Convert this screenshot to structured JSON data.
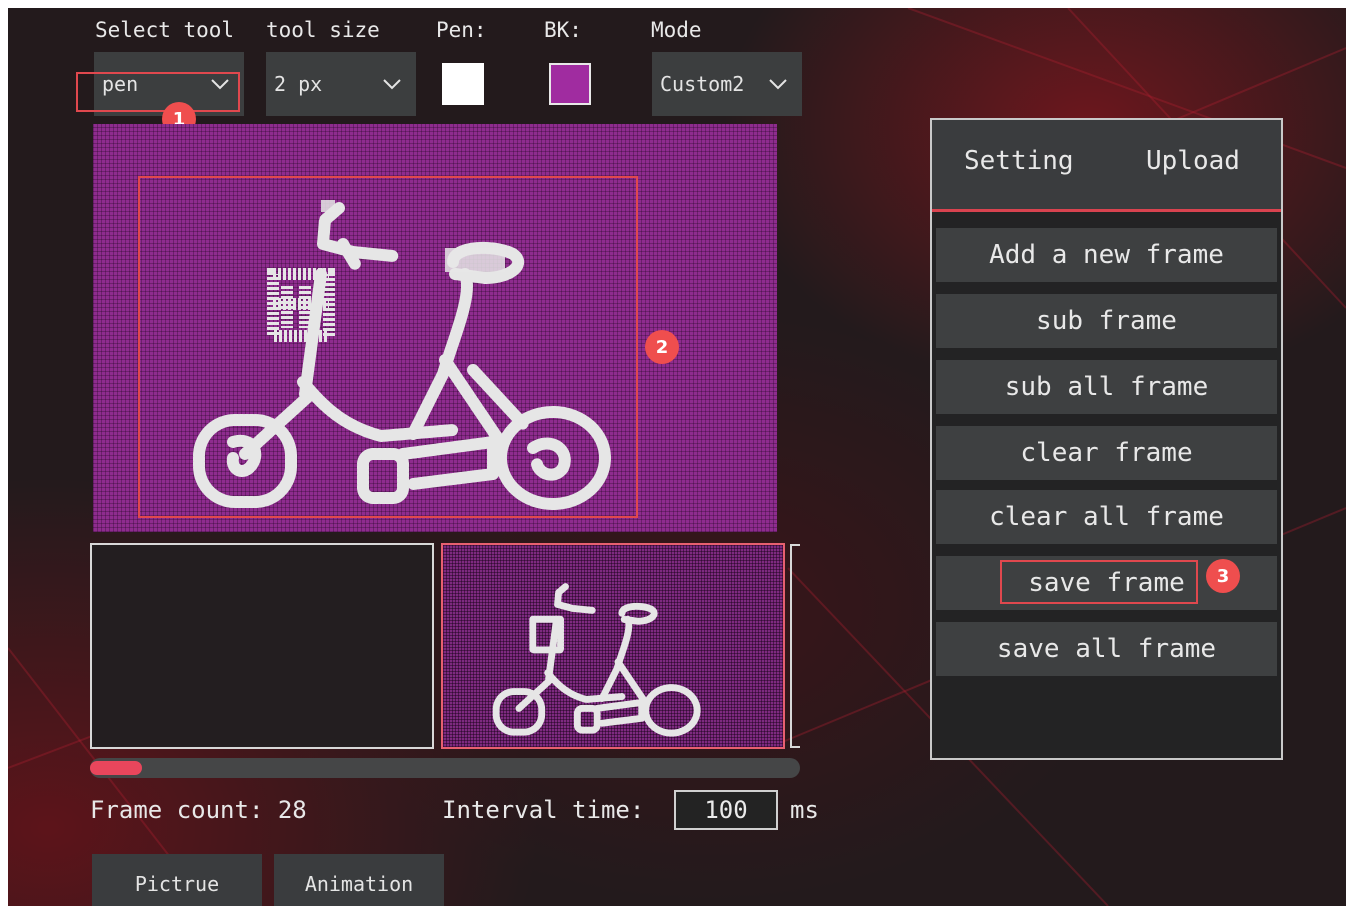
{
  "toolbar": {
    "select_tool_label": "Select tool",
    "select_tool_value": "pen",
    "tool_size_label": "tool size",
    "tool_size_value": "2 px",
    "pen_label": "Pen:",
    "pen_color": "#ffffff",
    "bk_label": "BK:",
    "bk_color": "#a02ca0",
    "mode_label": "Mode",
    "mode_value": "Custom2"
  },
  "callouts": {
    "one": "1",
    "two": "2",
    "three": "3"
  },
  "frames": {
    "frame_count_label": "Frame count: 28",
    "interval_label": "Interval time:",
    "interval_value": "100",
    "interval_unit": "ms",
    "scroll_position": 0.07
  },
  "bottom_tabs": {
    "picture": "Pictrue",
    "animation": "Animation"
  },
  "panel": {
    "tab_setting": "Setting",
    "tab_upload": "Upload",
    "buttons": {
      "add_new_frame": "Add a new frame",
      "sub_frame": "sub frame",
      "sub_all_frame": "sub all frame",
      "clear_frame": "clear frame",
      "clear_all_frame": "clear all frame",
      "save_frame": "save frame",
      "save_all_frame": "save all frame"
    }
  },
  "colors": {
    "accent": "#e8465c",
    "canvas_bg": "#8e2c8e",
    "panel_button": "#3e4041"
  },
  "icons": {
    "dropdown": "chevron-down-icon"
  }
}
